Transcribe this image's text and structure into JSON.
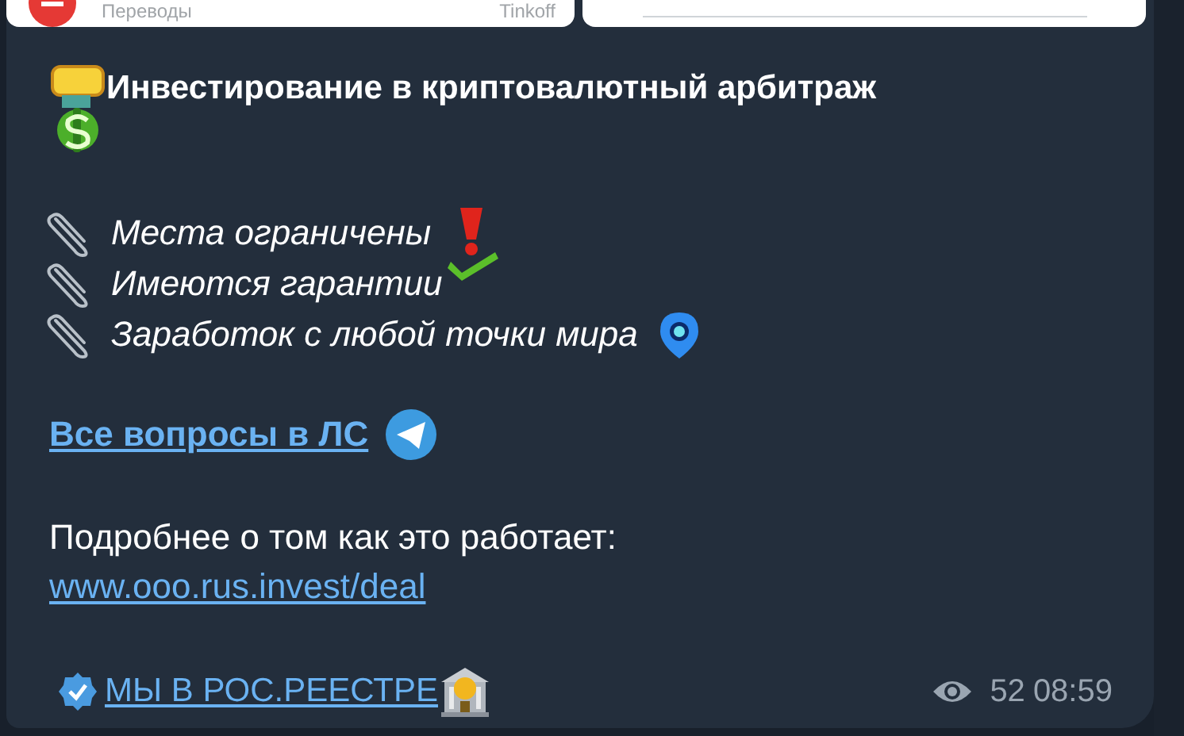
{
  "top_cards": [
    {
      "kind": "payment",
      "caption": "Переводы",
      "source": "Tinkoff"
    },
    {
      "kind": "blank"
    }
  ],
  "message": {
    "title": "Инвестирование в криптовалютный арбитраж",
    "features": [
      "Места ограничены",
      "Имеются гарантии",
      "Заработок с любой точки мира"
    ],
    "contact_link": "Все вопросы в ЛС",
    "info_text": "Подробнее о том как это работает:",
    "url": "www.ooo.rus.invest/deal",
    "registry_link": "МЫ В РОС.РЕЕСТРЕ",
    "views": "52",
    "time": "08:59"
  }
}
